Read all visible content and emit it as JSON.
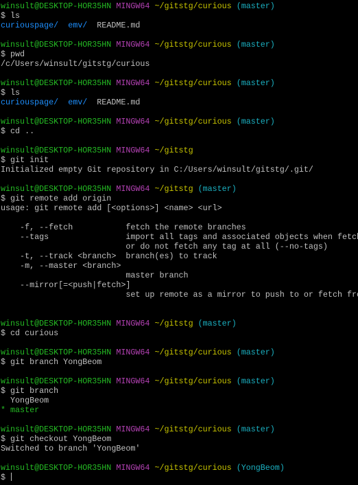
{
  "colors": {
    "user_host": "#25bc24",
    "mingw": "#b542b5",
    "path": "#c7c400",
    "branch": "#1bb1c2",
    "dir": "#1e90ff",
    "current_branch": "#25bc24",
    "text": "#c0c0c0",
    "background": "#000000"
  },
  "terminal": {
    "lines": [
      [
        {
          "t": "winsult@DESKTOP-HOR35HN",
          "c": "user_host"
        },
        {
          "t": " "
        },
        {
          "t": "MINGW64",
          "c": "mingw"
        },
        {
          "t": " "
        },
        {
          "t": "~/gitstg/curious",
          "c": "path"
        },
        {
          "t": " "
        },
        {
          "t": "(master)",
          "c": "branch"
        }
      ],
      [
        {
          "t": "$ ls"
        }
      ],
      [
        {
          "t": "curiouspage/",
          "c": "dir"
        },
        {
          "t": "  "
        },
        {
          "t": "emv/",
          "c": "dir"
        },
        {
          "t": "  README.md"
        }
      ],
      [],
      [
        {
          "t": "winsult@DESKTOP-HOR35HN",
          "c": "user_host"
        },
        {
          "t": " "
        },
        {
          "t": "MINGW64",
          "c": "mingw"
        },
        {
          "t": " "
        },
        {
          "t": "~/gitstg/curious",
          "c": "path"
        },
        {
          "t": " "
        },
        {
          "t": "(master)",
          "c": "branch"
        }
      ],
      [
        {
          "t": "$ pwd"
        }
      ],
      [
        {
          "t": "/c/Users/winsult/gitstg/curious"
        }
      ],
      [],
      [
        {
          "t": "winsult@DESKTOP-HOR35HN",
          "c": "user_host"
        },
        {
          "t": " "
        },
        {
          "t": "MINGW64",
          "c": "mingw"
        },
        {
          "t": " "
        },
        {
          "t": "~/gitstg/curious",
          "c": "path"
        },
        {
          "t": " "
        },
        {
          "t": "(master)",
          "c": "branch"
        }
      ],
      [
        {
          "t": "$ ls"
        }
      ],
      [
        {
          "t": "curiouspage/",
          "c": "dir"
        },
        {
          "t": "  "
        },
        {
          "t": "emv/",
          "c": "dir"
        },
        {
          "t": "  README.md"
        }
      ],
      [],
      [
        {
          "t": "winsult@DESKTOP-HOR35HN",
          "c": "user_host"
        },
        {
          "t": " "
        },
        {
          "t": "MINGW64",
          "c": "mingw"
        },
        {
          "t": " "
        },
        {
          "t": "~/gitstg/curious",
          "c": "path"
        },
        {
          "t": " "
        },
        {
          "t": "(master)",
          "c": "branch"
        }
      ],
      [
        {
          "t": "$ cd .."
        }
      ],
      [],
      [
        {
          "t": "winsult@DESKTOP-HOR35HN",
          "c": "user_host"
        },
        {
          "t": " "
        },
        {
          "t": "MINGW64",
          "c": "mingw"
        },
        {
          "t": " "
        },
        {
          "t": "~/gitstg",
          "c": "path"
        }
      ],
      [
        {
          "t": "$ git init"
        }
      ],
      [
        {
          "t": "Initialized empty Git repository in C:/Users/winsult/gitstg/.git/"
        }
      ],
      [],
      [
        {
          "t": "winsult@DESKTOP-HOR35HN",
          "c": "user_host"
        },
        {
          "t": " "
        },
        {
          "t": "MINGW64",
          "c": "mingw"
        },
        {
          "t": " "
        },
        {
          "t": "~/gitstg",
          "c": "path"
        },
        {
          "t": " "
        },
        {
          "t": "(master)",
          "c": "branch"
        }
      ],
      [
        {
          "t": "$ git remote add origin"
        }
      ],
      [
        {
          "t": "usage: git remote add [<options>] <name> <url>"
        }
      ],
      [],
      [
        {
          "t": "    -f, --fetch           fetch the remote branches"
        }
      ],
      [
        {
          "t": "    --tags                import all tags and associated objects when fetching"
        }
      ],
      [
        {
          "t": "                          or do not fetch any tag at all (--no-tags)"
        }
      ],
      [
        {
          "t": "    -t, --track <branch>  branch(es) to track"
        }
      ],
      [
        {
          "t": "    -m, --master <branch>"
        }
      ],
      [
        {
          "t": "                          master branch"
        }
      ],
      [
        {
          "t": "    --mirror[=<push|fetch>]"
        }
      ],
      [
        {
          "t": "                          set up remote as a mirror to push to or fetch from"
        }
      ],
      [],
      [],
      [
        {
          "t": "winsult@DESKTOP-HOR35HN",
          "c": "user_host"
        },
        {
          "t": " "
        },
        {
          "t": "MINGW64",
          "c": "mingw"
        },
        {
          "t": " "
        },
        {
          "t": "~/gitstg",
          "c": "path"
        },
        {
          "t": " "
        },
        {
          "t": "(master)",
          "c": "branch"
        }
      ],
      [
        {
          "t": "$ cd curious"
        }
      ],
      [],
      [
        {
          "t": "winsult@DESKTOP-HOR35HN",
          "c": "user_host"
        },
        {
          "t": " "
        },
        {
          "t": "MINGW64",
          "c": "mingw"
        },
        {
          "t": " "
        },
        {
          "t": "~/gitstg/curious",
          "c": "path"
        },
        {
          "t": " "
        },
        {
          "t": "(master)",
          "c": "branch"
        }
      ],
      [
        {
          "t": "$ git branch YongBeom"
        }
      ],
      [],
      [
        {
          "t": "winsult@DESKTOP-HOR35HN",
          "c": "user_host"
        },
        {
          "t": " "
        },
        {
          "t": "MINGW64",
          "c": "mingw"
        },
        {
          "t": " "
        },
        {
          "t": "~/gitstg/curious",
          "c": "path"
        },
        {
          "t": " "
        },
        {
          "t": "(master)",
          "c": "branch"
        }
      ],
      [
        {
          "t": "$ git branch"
        }
      ],
      [
        {
          "t": "  YongBeom"
        }
      ],
      [
        {
          "t": "* master",
          "c": "current_branch"
        }
      ],
      [],
      [
        {
          "t": "winsult@DESKTOP-HOR35HN",
          "c": "user_host"
        },
        {
          "t": " "
        },
        {
          "t": "MINGW64",
          "c": "mingw"
        },
        {
          "t": " "
        },
        {
          "t": "~/gitstg/curious",
          "c": "path"
        },
        {
          "t": " "
        },
        {
          "t": "(master)",
          "c": "branch"
        }
      ],
      [
        {
          "t": "$ git checkout YongBeom"
        }
      ],
      [
        {
          "t": "Switched to branch 'YongBeom'"
        }
      ],
      [],
      [
        {
          "t": "winsult@DESKTOP-HOR35HN",
          "c": "user_host"
        },
        {
          "t": " "
        },
        {
          "t": "MINGW64",
          "c": "mingw"
        },
        {
          "t": " "
        },
        {
          "t": "~/gitstg/curious",
          "c": "path"
        },
        {
          "t": " "
        },
        {
          "t": "(YongBeom)",
          "c": "branch"
        }
      ],
      [
        {
          "t": "$ "
        }
      ]
    ]
  }
}
